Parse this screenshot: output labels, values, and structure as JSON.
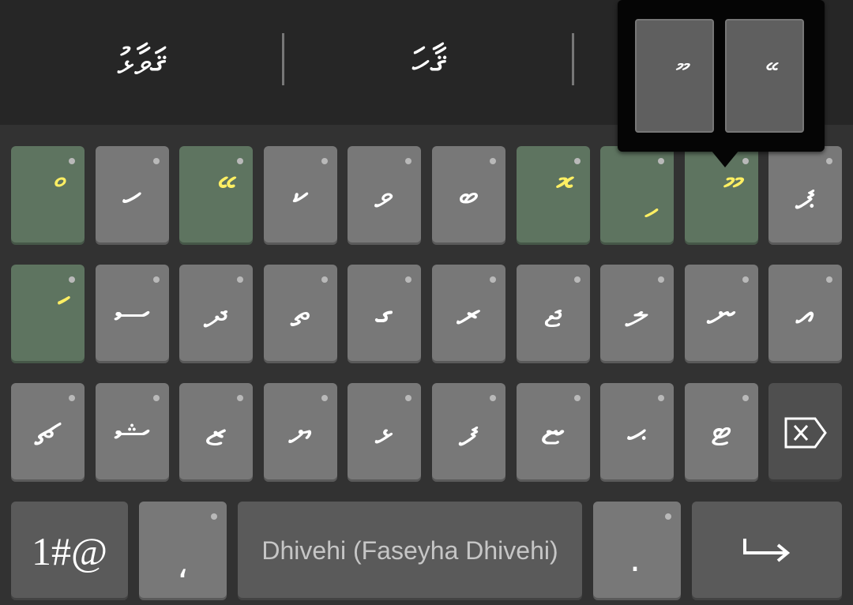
{
  "suggestions": [
    "ޤަވާޅު",
    "ޤާހަ",
    ""
  ],
  "rows": [
    [
      {
        "label": "ް",
        "hl": true
      },
      {
        "label": "ހ",
        "hl": false
      },
      {
        "label": "ޭ",
        "hl": true
      },
      {
        "label": "ކ",
        "hl": false
      },
      {
        "label": "ވ",
        "hl": false
      },
      {
        "label": "ބ",
        "hl": false
      },
      {
        "label": "ޮ",
        "hl": true
      },
      {
        "label": "ި",
        "hl": true
      },
      {
        "label": "ޫ",
        "hl": true
      },
      {
        "label": "ޕ",
        "hl": false
      }
    ],
    [
      {
        "label": "ަ",
        "hl": true
      },
      {
        "label": "ސ",
        "hl": false
      },
      {
        "label": "ދ",
        "hl": false
      },
      {
        "label": "ތ",
        "hl": false
      },
      {
        "label": "ގ",
        "hl": false
      },
      {
        "label": "ރ",
        "hl": false
      },
      {
        "label": "ޖ",
        "hl": false
      },
      {
        "label": "ލ",
        "hl": false
      },
      {
        "label": "ނ",
        "hl": false
      },
      {
        "label": "އ",
        "hl": false
      }
    ],
    [
      {
        "label": "ޗ",
        "hl": false
      },
      {
        "label": "ޝ",
        "hl": false
      },
      {
        "label": "ޒ",
        "hl": false
      },
      {
        "label": "ޔ",
        "hl": false
      },
      {
        "label": "ޅ",
        "hl": false
      },
      {
        "label": "ފ",
        "hl": false
      },
      {
        "label": "ޏ",
        "hl": false
      },
      {
        "label": "ޙ",
        "hl": false
      },
      {
        "label": "ޓ",
        "hl": false
      }
    ]
  ],
  "bottom": {
    "symbols_label": "1#@",
    "comma_label": "،",
    "space_label": "Dhivehi (Faseyha Dhivehi)",
    "period_label": ".",
    "enter_icon": "enter-arrow-icon",
    "backspace_icon": "backspace-icon"
  },
  "popup": {
    "options": [
      "ޫ",
      "ޭ"
    ]
  },
  "colors": {
    "key": "#787878",
    "highlight_key": "#5e7460",
    "highlight_glyph": "#ffef63",
    "background": "#323232",
    "suggestion_bar": "#262626"
  }
}
